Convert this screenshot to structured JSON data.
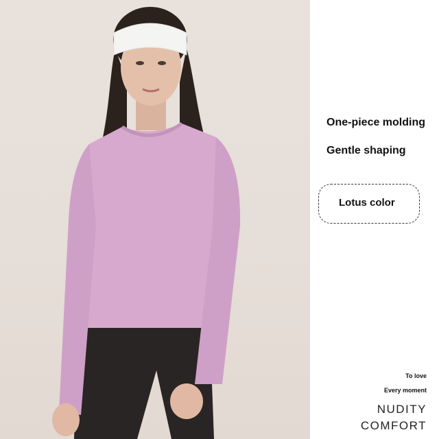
{
  "features": [
    "One-piece molding",
    "Gentle shaping"
  ],
  "color_option": "Lotus color",
  "tagline_small": [
    "To love",
    "Every moment"
  ],
  "tagline_big": [
    "NUDITY",
    "COMFORT"
  ],
  "colors": {
    "shirt": "#d7a9cf",
    "leggings": "#2a2525",
    "background": "#e7e0da",
    "headband": "#f4f4f2"
  }
}
